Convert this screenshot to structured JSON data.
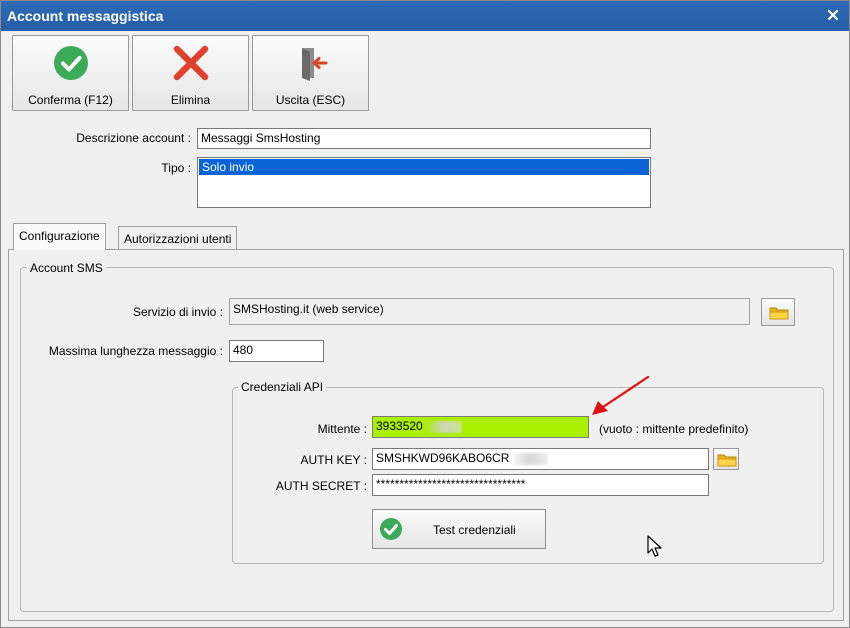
{
  "window": {
    "title": "Account messaggistica"
  },
  "toolbar": {
    "confirm_label": "Conferma (F12)",
    "delete_label": "Elimina",
    "exit_label": "Uscita (ESC)"
  },
  "form": {
    "description_label": "Descrizione account :",
    "description_value": "Messaggi SmsHosting",
    "type_label": "Tipo :",
    "type_selected": "Solo invio"
  },
  "tabs": [
    {
      "label": "Configurazione",
      "active": true
    },
    {
      "label": "Autorizzazioni utenti",
      "active": false
    }
  ],
  "sms_group": {
    "title": "Account SMS",
    "service_label": "Servizio di invio :",
    "service_value": "SMSHosting.it (web service)",
    "maxlen_label": "Massima lunghezza messaggio :",
    "maxlen_value": "480"
  },
  "api_group": {
    "title": "Credenziali API",
    "sender_label": "Mittente :",
    "sender_value": "3933520",
    "sender_hint": "(vuoto : mittente predefinito)",
    "authkey_label": "AUTH KEY :",
    "authkey_value": "SMSHKWD96KABO6CR",
    "authsecret_label": "AUTH SECRET :",
    "authsecret_value": "********************************",
    "test_label": "Test credenziali"
  },
  "colors": {
    "titlebar": "#2b65b0",
    "sender_highlight": "#aaee00",
    "selection": "#0a64d6",
    "annotation_arrow": "#e01010"
  }
}
